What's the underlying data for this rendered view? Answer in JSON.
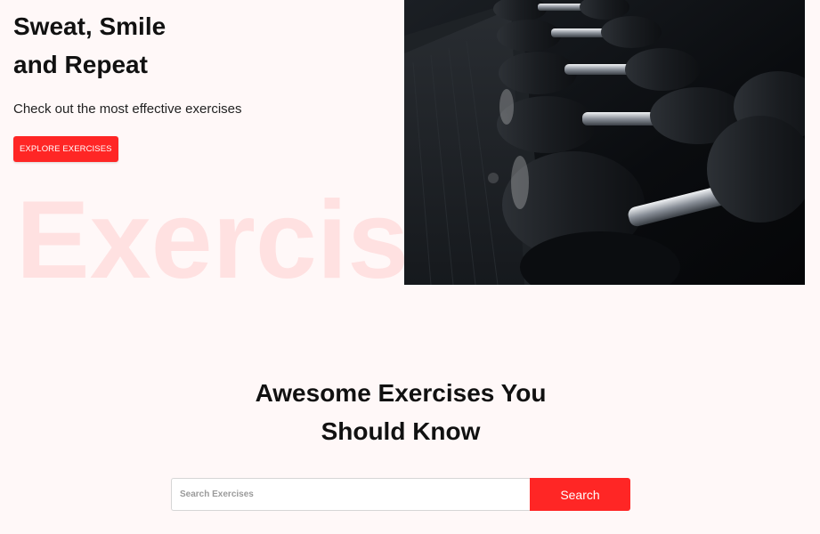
{
  "hero": {
    "title_line1": "Sweat, Smile",
    "title_line2": "and Repeat",
    "subtitle": "Check out the most effective exercises",
    "explore_button": "EXPLORE EXERCISES",
    "watermark": "Exercise",
    "image_icon": "dumbbell-rack-photo"
  },
  "section": {
    "title_line1": "Awesome Exercises You",
    "title_line2": "Should Know"
  },
  "search": {
    "placeholder": "Search Exercises",
    "value": "",
    "button_label": "Search"
  },
  "colors": {
    "accent": "#ff2625",
    "background": "#fff8f8",
    "text": "#111111"
  }
}
